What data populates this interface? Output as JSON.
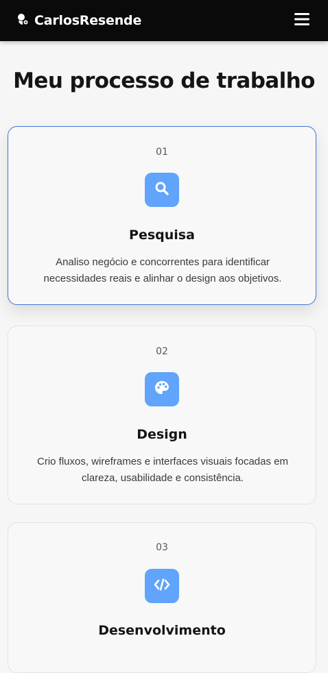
{
  "navbar": {
    "brand": "CarlosResende",
    "brand_icon": "person-icon",
    "menu_icon": "hamburger-icon"
  },
  "page_title": "Meu processo de trabalho",
  "steps": [
    {
      "number": "01",
      "icon": "search-icon",
      "title": "Pesquisa",
      "description": "Analiso negócio e concorrentes para identificar necessidades reais e alinhar o design aos objetivos.",
      "active": true
    },
    {
      "number": "02",
      "icon": "palette-icon",
      "title": "Design",
      "description": "Crio fluxos, wireframes e interfaces visuais focadas em clareza, usabilidade e consistência.",
      "active": false
    },
    {
      "number": "03",
      "icon": "code-icon",
      "title": "Desenvolvimento",
      "description": "",
      "active": false
    }
  ],
  "colors": {
    "navbar_bg": "#0a0a0a",
    "accent": "#60a4fb",
    "active_border": "#3d73d6",
    "page_bg": "#f6f6f6"
  }
}
